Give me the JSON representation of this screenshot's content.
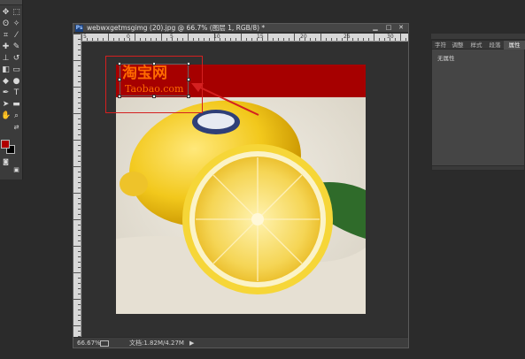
{
  "document": {
    "title": "webwxgetmsgimg (20).jpg @ 66.7% (图层 1, RGB/8) *",
    "ps_badge": "Ps",
    "zoom": "66.67%",
    "doc_size": "文档:1.82M/4.27M",
    "ruler_labels": [
      "5",
      "0",
      "5",
      "10",
      "15",
      "20",
      "25",
      "30"
    ]
  },
  "logo": {
    "chinese": "淘宝网",
    "english": "Taobao.com",
    "color": "#ff6a00"
  },
  "canvas": {
    "banner_color": "#a60000",
    "arrow_color": "#d42020"
  },
  "right_panel": {
    "tabs": [
      "字符",
      "调整",
      "样式",
      "段落",
      "属性"
    ],
    "active_tab": "属性",
    "content_label": "无属性"
  },
  "tools": {
    "foreground_color": "#b00000",
    "background_color": "#000000",
    "items": [
      "move-icon",
      "marquee-icon",
      "lasso-icon",
      "magic-wand-icon",
      "crop-icon",
      "eyedropper-icon",
      "healing-icon",
      "brush-icon",
      "stamp-icon",
      "history-brush-icon",
      "eraser-icon",
      "gradient-icon",
      "blur-icon",
      "dodge-icon",
      "pen-icon",
      "type-icon",
      "path-select-icon",
      "shape-icon",
      "hand-icon",
      "zoom-icon"
    ]
  }
}
